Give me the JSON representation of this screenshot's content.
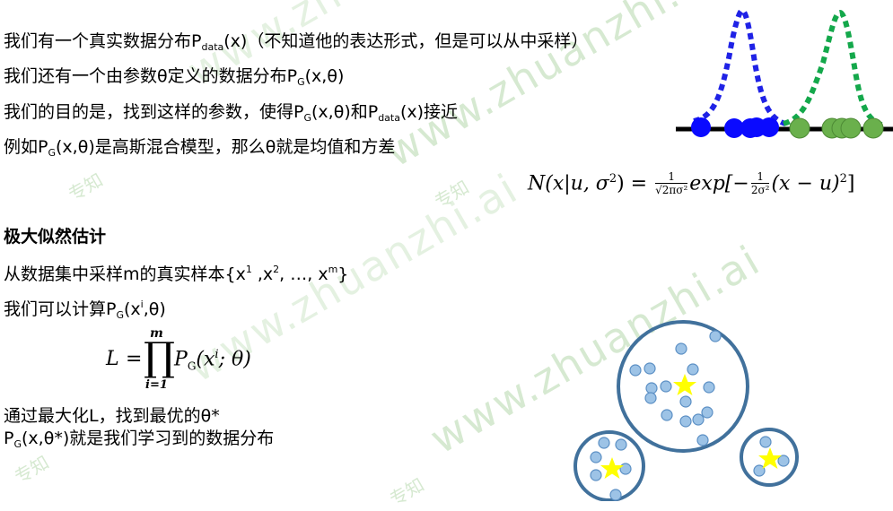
{
  "lines": {
    "l1_a": "我们有一个真实数据分布P",
    "l1_sub": "data",
    "l1_b": "(x)（不知道他的表达形式，但是可以从中采样）",
    "l2_a": "我们还有一个由参数θ定义的数据分布P",
    "l2_sub": "G",
    "l2_b": "(x,θ)",
    "l3_a": "我们的目的是，找到这样的参数，使得P",
    "l3_sub1": "G",
    "l3_b": "(x,θ)和P",
    "l3_sub2": "data",
    "l3_c": "(x)接近",
    "l4_a": "例如P",
    "l4_sub": "G",
    "l4_b": "(x,θ)是高斯混合模型，那么θ就是均值和方差",
    "heading": "极大似然估计",
    "l6_a": "从数据集中采样m的真实样本{x",
    "l6_sup1": "1",
    "l6_b": " ,x",
    "l6_sup2": "2",
    "l6_c": ", …, x",
    "l6_sup3": "m",
    "l6_d": "}",
    "l7_a": "我们可以计算P",
    "l7_sub": "G",
    "l7_b": "(x",
    "l7_sup": "i",
    "l7_c": ",θ)",
    "l8": "通过最大化L，找到最优的θ*",
    "l9_a": "P",
    "l9_sub": "G",
    "l9_b": "(x,θ*)就是我们学习到的数据分布"
  },
  "gauss_formula": {
    "lhs": "N(x|u, σ",
    "lhs_sup": "2",
    "lhs_end": ") =",
    "frac1_num": "1",
    "frac1_den": "√2πσ²",
    "mid": "exp[−",
    "frac2_num": "1",
    "frac2_den": "2σ²",
    "rhs": "(x − u)",
    "rhs_sup": "2",
    "rhs_end": "]"
  },
  "likelihood_formula": {
    "L": "L",
    "eq": "=",
    "prod": "∏",
    "upper": "m",
    "lower": "i=1",
    "P": "P",
    "P_sub": "G",
    "open": "(x",
    "sup": "i",
    "rest": "; θ)"
  },
  "watermarks": {
    "big": "www.zhuanzhi.ai",
    "small": "专知"
  },
  "colors": {
    "blue_curve": "#1f22e6",
    "green_curve": "#14a84b",
    "blue_dot": "#0a0aff",
    "green_dot": "#6ab04c",
    "cluster_ring": "#41719c",
    "cluster_point": "#9dc3e6",
    "star": "#ffff00"
  }
}
